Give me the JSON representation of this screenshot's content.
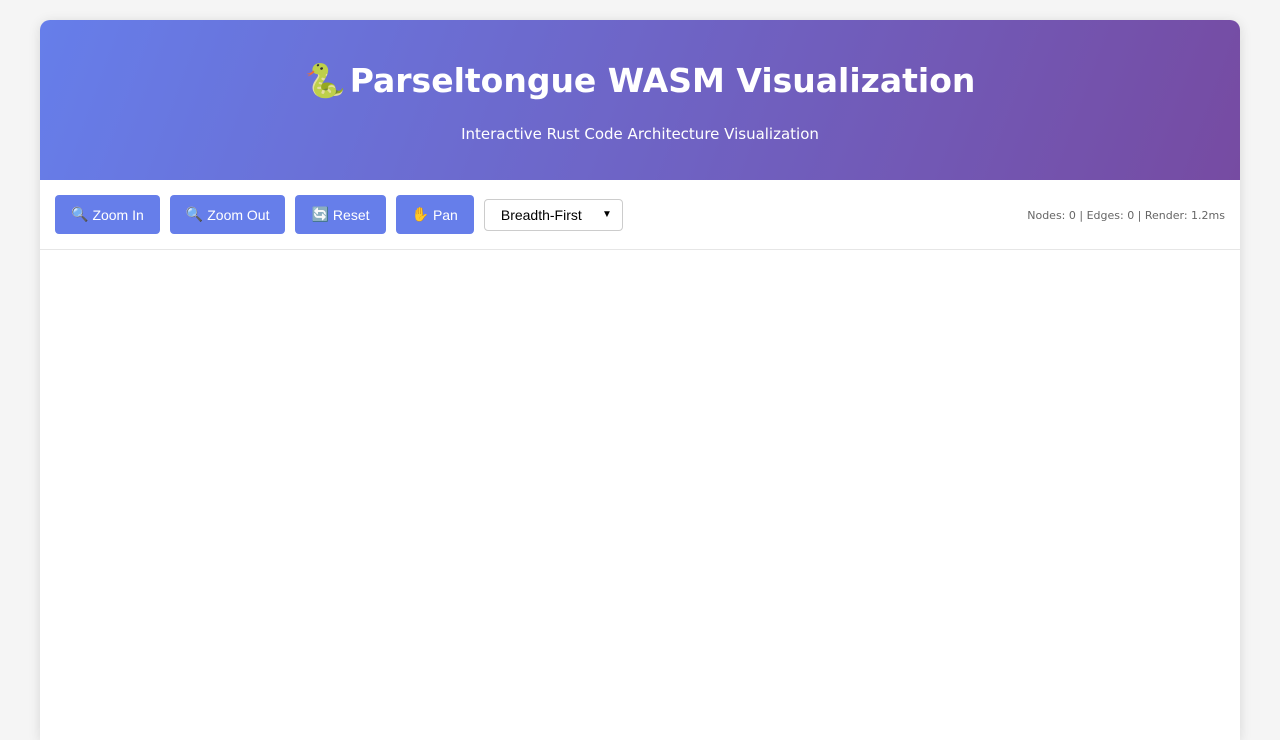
{
  "header": {
    "logo_glyph": "🐍",
    "title": "Parseltongue WASM Visualization",
    "subtitle": "Interactive Rust Code Architecture Visualization"
  },
  "toolbar": {
    "buttons": [
      {
        "icon": "🔍",
        "icon_name": "magnifier-icon",
        "label": "Zoom In"
      },
      {
        "icon": "🔍",
        "icon_name": "magnifier-icon",
        "label": "Zoom Out"
      },
      {
        "icon": "🔄",
        "icon_name": "refresh-icon",
        "label": "Reset"
      },
      {
        "icon": "✋",
        "icon_name": "hand-icon",
        "label": "Pan"
      }
    ],
    "layout_select": {
      "selected": "Breadth-First"
    },
    "stats": "Nodes: 0 | Edges: 0 | Render: 1.2ms"
  },
  "colors": {
    "accent": "#667eea",
    "gradient_end": "#764ba2"
  }
}
